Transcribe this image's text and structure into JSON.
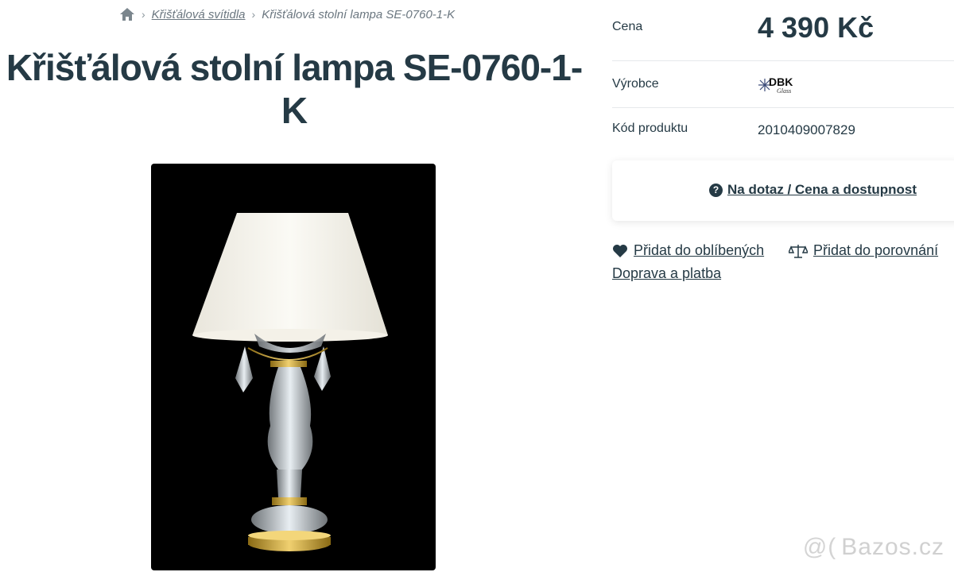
{
  "breadcrumb": {
    "items": [
      "Křišťálová svítidla",
      "Křišťálová stolní lampa SE-0760-1-K"
    ]
  },
  "title": "Křišťálová stolní lampa SE-0760-1-K",
  "info": {
    "price_label": "Cena",
    "price_value": "4 390 Kč",
    "maker_label": "Výrobce",
    "maker_logo_text": "DBK",
    "maker_logo_sub": "Glass",
    "code_label": "Kód produktu",
    "code_value": "2010409007829"
  },
  "inquiry": {
    "label": "Na dotaz / Cena a dostupnost"
  },
  "actions": {
    "favorite": "Přidat do oblíbených",
    "compare": "Přidat do porovnání",
    "shipping": "Doprava a platba"
  },
  "watermark": {
    "text": "Bazos.cz"
  },
  "colors": {
    "text": "#253a45",
    "muted": "#6b7780",
    "image_bg": "#000000",
    "gold": "#d4a82a"
  }
}
